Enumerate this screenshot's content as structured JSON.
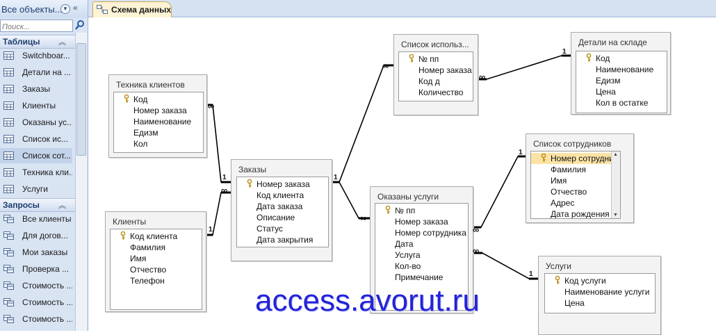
{
  "nav": {
    "title": "Все объекты...",
    "search_placeholder": "Поиск...",
    "groups": [
      {
        "label": "Таблицы",
        "items": [
          "Switchboar...",
          "Детали на ...",
          "Заказы",
          "Клиенты",
          "Оказаны ус...",
          "Список ис...",
          "Список сот...",
          "Техника кли...",
          "Услуги"
        ],
        "selected_index": 6
      },
      {
        "label": "Запросы",
        "items": [
          "Все клиенты",
          "Для догов...",
          "Мои заказы",
          "Проверка ...",
          "Стоимость ...",
          "Стоимость ...",
          "Стоимость ..."
        ]
      }
    ]
  },
  "tab": {
    "label": "Схема данных"
  },
  "tables": [
    {
      "title": "Техника клиентов",
      "fields": [
        "Код",
        "Номер заказа",
        "Наименование",
        "Едизм",
        "Кол"
      ],
      "key_field_index": 0
    },
    {
      "title": "Клиенты",
      "fields": [
        "Код клиента",
        "Фамилия",
        "Имя",
        "Отчество",
        "Телефон"
      ],
      "key_field_index": 0
    },
    {
      "title": "Заказы",
      "fields": [
        "Номер заказа",
        "Код клиента",
        "Дата заказа",
        "Описание",
        "Статус",
        "Дата закрытия"
      ],
      "key_field_index": 0
    },
    {
      "title": "Список использ...",
      "fields": [
        "№ пп",
        "Номер заказа",
        "Код д",
        "Количество"
      ],
      "key_field_index": 0
    },
    {
      "title": "Детали на складе",
      "fields": [
        "Код",
        "Наименование",
        "Едизм",
        "Цена",
        "Кол в остатке"
      ],
      "key_field_index": 0
    },
    {
      "title": "Оказаны услуги",
      "fields": [
        "№ пп",
        "Номер заказа",
        "Номер сотрудника",
        "Дата",
        "Услуга",
        "Кол-во",
        "Примечание"
      ],
      "key_field_index": 0
    },
    {
      "title": "Список сотрудников",
      "fields": [
        "Номер сотрудника",
        "Фамилия",
        "Имя",
        "Отчество",
        "Адрес",
        "Дата рождения"
      ],
      "key_field_index": 0,
      "highlighted_index": 0,
      "has_scrollbar": true
    },
    {
      "title": "Услуги",
      "fields": [
        "Код услуги",
        "Наименование услуги",
        "Цена"
      ],
      "key_field_index": 0
    }
  ],
  "relationships": [
    {
      "from": "Техника клиентов",
      "to": "Заказы",
      "one": "1",
      "many": "∞"
    },
    {
      "from": "Клиенты",
      "to": "Заказы",
      "one": "1",
      "many": "∞"
    },
    {
      "from": "Заказы",
      "to": "Список использ...",
      "one": "1",
      "many": "∞"
    },
    {
      "from": "Заказы",
      "to": "Оказаны услуги",
      "one": "1",
      "many": "∞"
    },
    {
      "from": "Детали на складе",
      "to": "Список использ...",
      "one": "1",
      "many": "∞"
    },
    {
      "from": "Список сотрудников",
      "to": "Оказаны услуги",
      "one": "1",
      "many": "∞"
    },
    {
      "from": "Услуги",
      "to": "Оказаны услуги",
      "one": "1",
      "many": "∞"
    }
  ],
  "watermark": "access.avorut.ru",
  "colors": {
    "nav_bg": "#d9e4f3",
    "tab_bg": "#fef3d4",
    "highlight": "#fbe3a6",
    "watermark": "#2323d6"
  }
}
